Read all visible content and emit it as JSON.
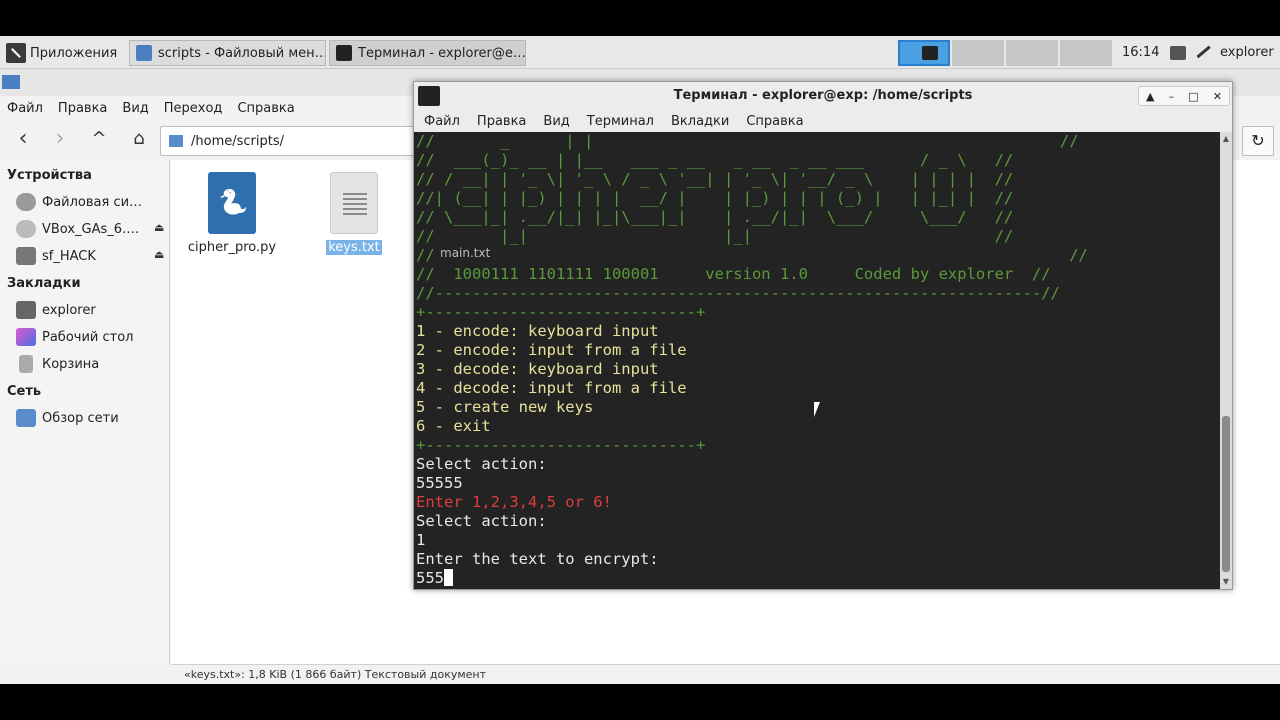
{
  "panel": {
    "apps_label": "Приложения",
    "tasks": [
      {
        "label": "scripts - Файловый мен…"
      },
      {
        "label": "Терминал - explorer@e…"
      }
    ],
    "clock": "16:14",
    "user": "explorer"
  },
  "fm": {
    "menu": [
      "Файл",
      "Правка",
      "Вид",
      "Переход",
      "Справка"
    ],
    "path": "/home/scripts/",
    "sidebar": {
      "devices_header": "Устройства",
      "devices": [
        {
          "label": "Файловая си…"
        },
        {
          "label": "VBox_GAs_6.…"
        },
        {
          "label": "sf_HACK"
        }
      ],
      "bookmarks_header": "Закладки",
      "bookmarks": [
        {
          "label": "explorer"
        },
        {
          "label": "Рабочий стол"
        },
        {
          "label": "Корзина"
        }
      ],
      "network_header": "Сеть",
      "network": [
        {
          "label": "Обзор сети"
        }
      ]
    },
    "files": [
      {
        "name": "cipher_pro.py"
      },
      {
        "name": "keys.txt"
      }
    ],
    "status": "«keys.txt»: 1,8 KiB (1 866 байт) Текстовый документ"
  },
  "terminal": {
    "title": "Терминал - explorer@exp: /home/scripts",
    "menu": [
      "Файл",
      "Правка",
      "Вид",
      "Терминал",
      "Вкладки",
      "Справка"
    ],
    "ghost_file": "main.txt",
    "banner": [
      "//       _      | |                                                  //",
      "//  ___(_)_ __ | |__   ___ _ __   _ __  _ __ ___      / _ \\   //",
      "// / __| | '_ \\| '_ \\ / _ \\ '__| | '_ \\| '__/ _ \\    | | | |  //",
      "//| (__| | |_) | | | |  __/ |    | |_) | | | (_) |   | |_| |  //",
      "// \\___|_| .__/|_| |_|\\___|_|    | .__/|_|  \\___/     \\___/   //",
      "//       |_|                     |_|                          //",
      "//                                                                    //",
      "//  1000111 1101111 100001     version 1.0     Coded by explorer  //",
      "//-----------------------------------------------------------------//"
    ],
    "menu_border": "+-----------------------------+",
    "options": [
      "1 - encode: keyboard input",
      "2 - encode: input from a file",
      "3 - decode: keyboard input",
      "4 - decode: input from a file",
      "5 - create new keys",
      "6 - exit"
    ],
    "prompt1": "Select action:",
    "input1": "55555",
    "error": "Enter 1,2,3,4,5 or 6!",
    "prompt2": "Select action:",
    "input2": "1",
    "prompt3": "Enter the text to encrypt:",
    "input3": "555"
  },
  "colors": {
    "banner": "#5a9a3a",
    "menu_text": "#e6e29a",
    "error": "#e03c3c",
    "terminal_bg": "#232323"
  }
}
